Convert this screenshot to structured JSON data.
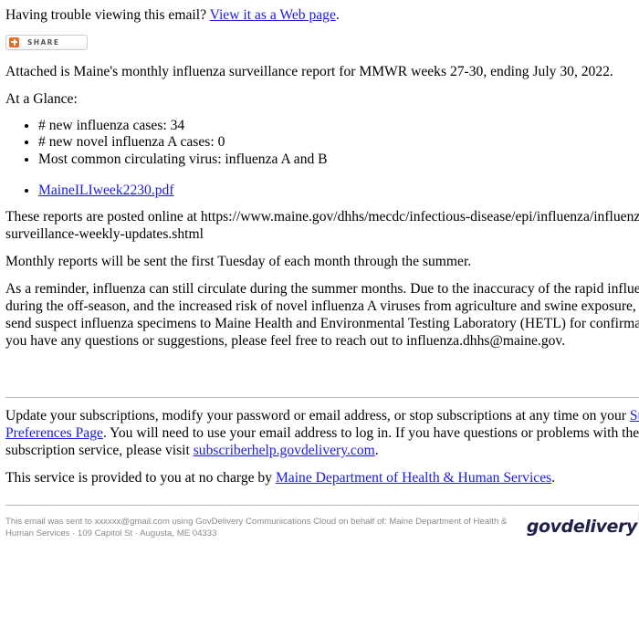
{
  "header": {
    "trouble_text_before": "Having trouble viewing this email? ",
    "trouble_link": "View it as a Web page",
    "trouble_text_after": "."
  },
  "share": {
    "label": "SHARE",
    "icon": "share-plus-icon",
    "icon_color": "#ec6a21"
  },
  "body": {
    "intro": "Attached is Maine's monthly influenza surveillance report for MMWR weeks 27-30, ending July 30, 2022.",
    "glance_heading": "At a Glance:",
    "glance_items": [
      "# new influenza cases: 34",
      "# new novel influenza A cases: 0",
      "Most common circulating virus: influenza A and B"
    ],
    "attachments": [
      "MaineILIweek2230.pdf"
    ],
    "posted_online": "These reports are posted online at https://www.maine.gov/dhhs/mecdc/infectious-disease/epi/influenza/influenza-surveillance-weekly-updates.shtml",
    "monthly_note": "Monthly reports will be sent the first Tuesday of each month through the summer.",
    "reminder": "As a reminder, influenza can still circulate during the summer months. Due to the inaccuracy of the rapid influenza tests during the off-season, and the increased risk of novel influenza A viruses from agriculture and swine exposure, please send suspect influenza specimens to Maine Health and Environmental Testing Laboratory (HETL) for confirmation. If you have any questions or suggestions, please feel free to reach out to influenza.dhhs@maine.gov."
  },
  "subscription": {
    "text_1": "Update your subscriptions, modify your password or email address, or stop subscriptions at any time on your ",
    "link_1": "Subscriber Preferences Page",
    "text_2": ". You will need to use your email address to log in. If you have questions or problems with the subscription service, please visit ",
    "link_2": "subscriberhelp.govdelivery.com",
    "text_3": "."
  },
  "service_note": {
    "text_before": "This service is provided to you at no charge by ",
    "link": "Maine Department of Health & Human Services",
    "text_after": "."
  },
  "footer": {
    "sent_notice": "This email was sent to xxxxxx@gmail.com using GovDelivery Communications Cloud on behalf of: Maine Department of Health & Human Services · 109 Capitol St · Augusta, ME 04333",
    "logo_text": "govdelivery",
    "logo_color": "#20214a"
  }
}
